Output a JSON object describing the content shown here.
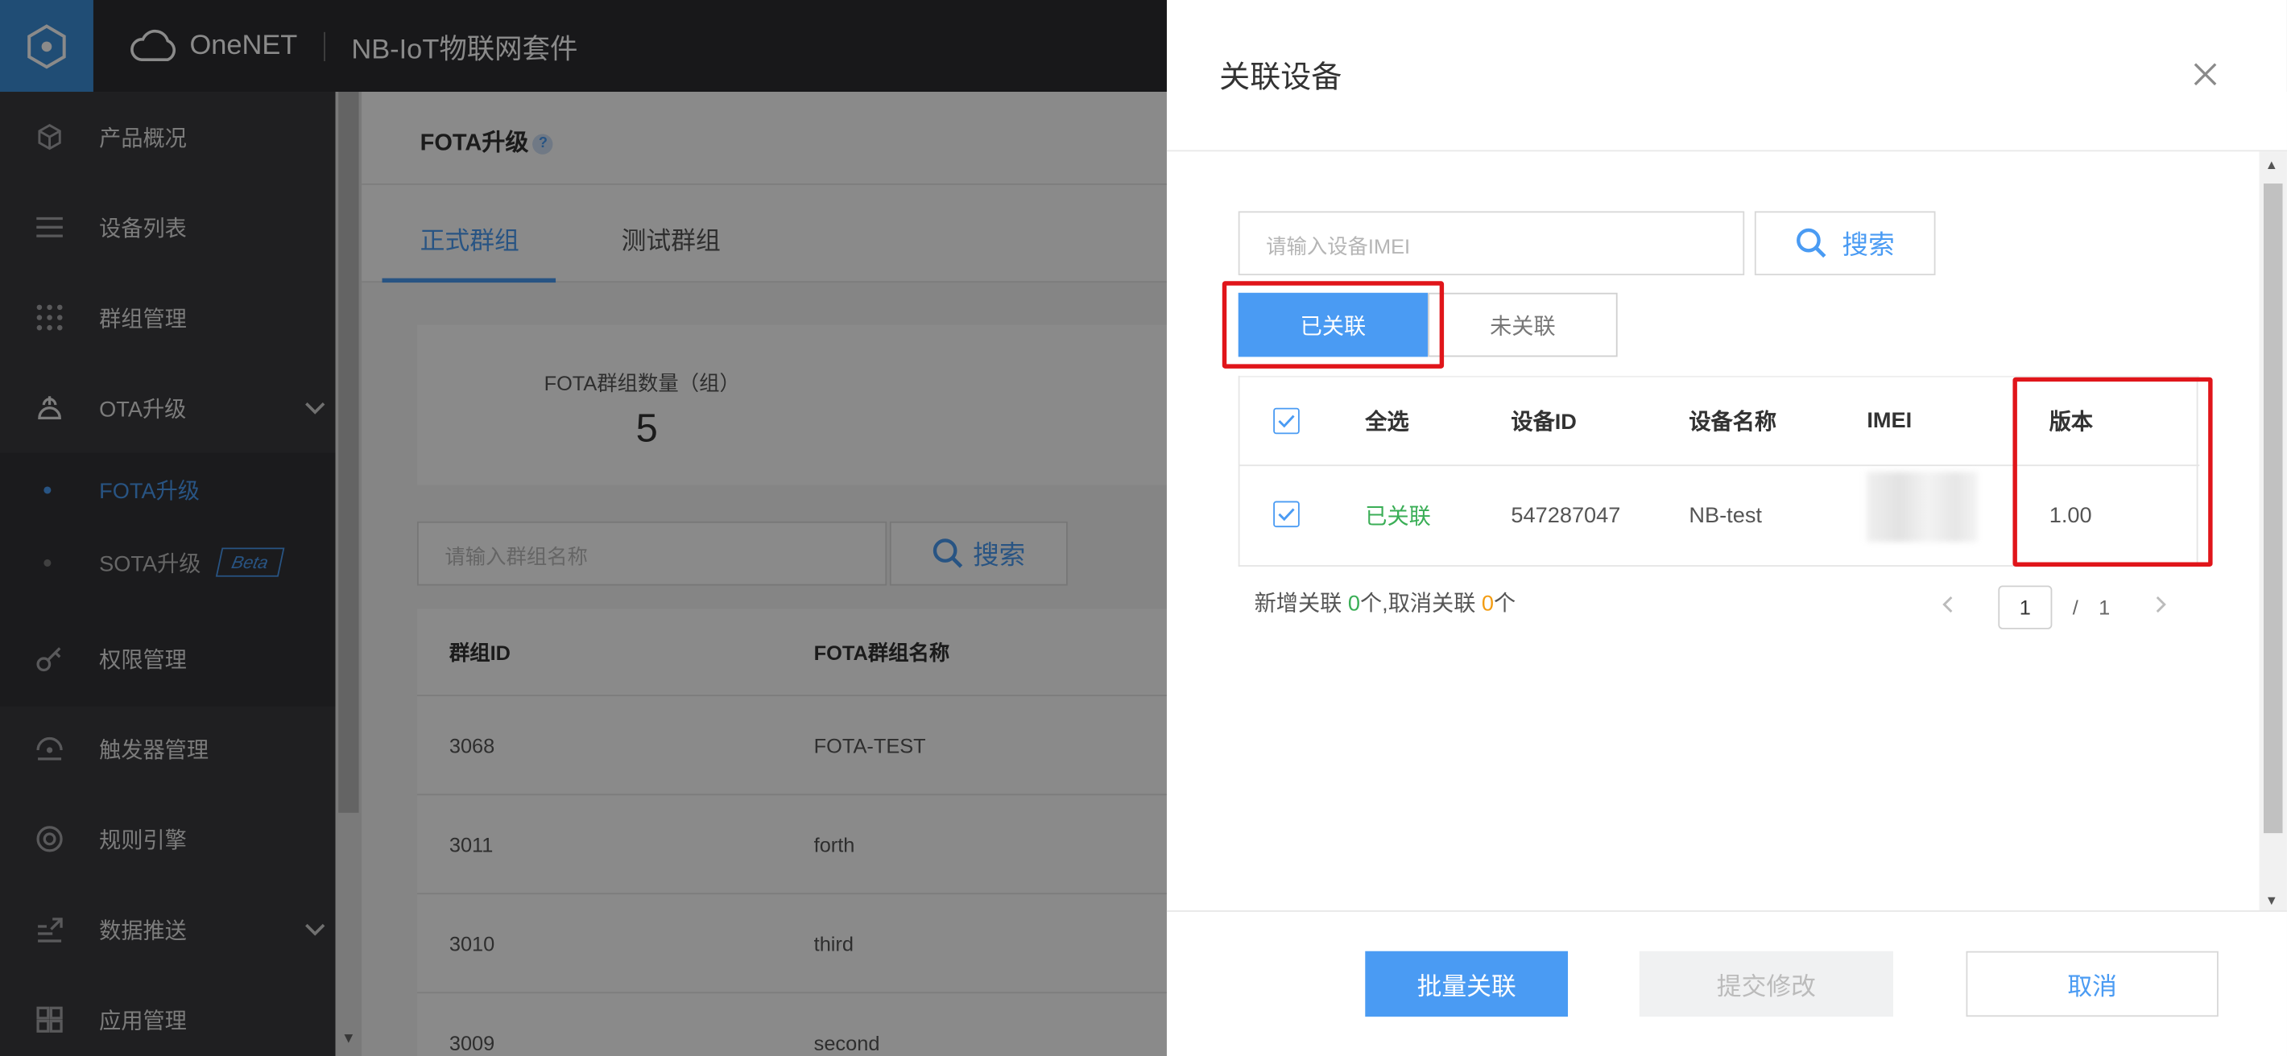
{
  "app": {
    "cloud_name": "OneNET",
    "suite_name": "NB-IoT物联网套件"
  },
  "sidebar": {
    "items": [
      {
        "label": "产品概况",
        "icon": "cube-icon"
      },
      {
        "label": "设备列表",
        "icon": "list-icon"
      },
      {
        "label": "群组管理",
        "icon": "grid-icon"
      },
      {
        "label": "OTA升级",
        "icon": "ota-icon"
      },
      {
        "label": "权限管理",
        "icon": "key-icon"
      },
      {
        "label": "触发器管理",
        "icon": "trigger-icon"
      },
      {
        "label": "规则引擎",
        "icon": "rule-icon"
      },
      {
        "label": "数据推送",
        "icon": "push-icon"
      },
      {
        "label": "应用管理",
        "icon": "apps-icon"
      }
    ],
    "ota_sub": [
      {
        "label": "FOTA升级"
      },
      {
        "label": "SOTA升级"
      }
    ],
    "beta_badge": "Beta"
  },
  "main": {
    "breadcrumb": "FOTA升级",
    "help_mark": "?",
    "tabs": [
      {
        "label": "正式群组"
      },
      {
        "label": "测试群组"
      }
    ],
    "stat": {
      "label": "FOTA群组数量（组）",
      "value": "5"
    },
    "search": {
      "placeholder": "请输入群组名称",
      "button": "搜索"
    },
    "table": {
      "columns": [
        "群组ID",
        "FOTA群组名称"
      ],
      "rows": [
        {
          "id": "3068",
          "name": "FOTA-TEST"
        },
        {
          "id": "3011",
          "name": "forth"
        },
        {
          "id": "3010",
          "name": "third"
        },
        {
          "id": "3009",
          "name": "second"
        }
      ]
    }
  },
  "modal": {
    "title": "关联设备",
    "search": {
      "placeholder": "请输入设备IMEI",
      "button": "搜索"
    },
    "filter": {
      "linked": "已关联",
      "unlinked": "未关联"
    },
    "table": {
      "columns": [
        "全选",
        "设备ID",
        "设备名称",
        "IMEI",
        "版本"
      ],
      "rows": [
        {
          "status": "已关联",
          "device_id": "547287047",
          "device_name": "NB-test",
          "version": "1.00"
        }
      ]
    },
    "summary": {
      "pre": "新增关联 ",
      "added": "0",
      "mid": "个,取消关联 ",
      "removed": "0",
      "post": "个"
    },
    "pager": {
      "current": "1",
      "sep": "/",
      "total": "1"
    },
    "footer": {
      "batch": "批量关联",
      "submit": "提交修改",
      "cancel": "取消"
    }
  },
  "colors": {
    "accent": "#4a9bf3",
    "highlight": "#e0151a",
    "linked_green": "#3aae56",
    "count_orange": "#f39c12"
  }
}
